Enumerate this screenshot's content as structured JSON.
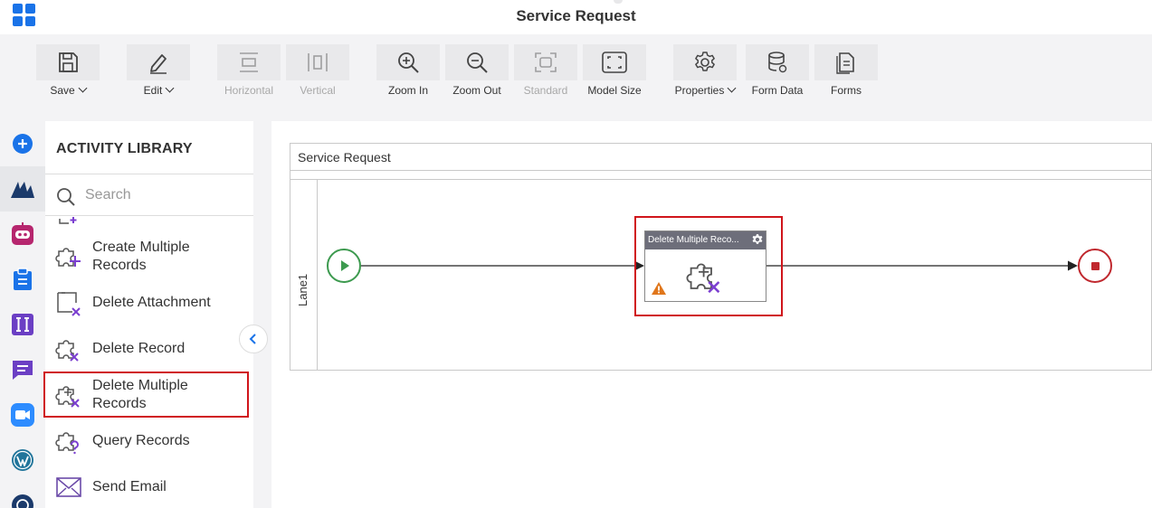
{
  "header": {
    "title": "Service Request"
  },
  "toolbar": {
    "items": [
      {
        "label": "Save",
        "icon": "save-icon"
      },
      {
        "label": "Edit",
        "icon": "pencil-icon"
      },
      {
        "label": "Horizontal",
        "icon": "align-horizontal-icon"
      },
      {
        "label": "Vertical",
        "icon": "align-vertical-icon"
      },
      {
        "label": "Zoom In",
        "icon": "zoom-in-icon"
      },
      {
        "label": "Zoom Out",
        "icon": "zoom-out-icon"
      },
      {
        "label": "Standard",
        "icon": "standard-view-icon"
      },
      {
        "label": "Model Size",
        "icon": "fit-screen-icon"
      },
      {
        "label": "Properties",
        "icon": "gear-icon"
      },
      {
        "label": "Form Data",
        "icon": "database-icon"
      },
      {
        "label": "Forms",
        "icon": "forms-icon"
      }
    ]
  },
  "library": {
    "title": "ACTIVITY LIBRARY",
    "search_placeholder": "Search",
    "items": [
      {
        "label": "Create Multiple Records",
        "icon": "puzzle-plus-icon"
      },
      {
        "label": "Delete Attachment",
        "icon": "attachment-delete-icon"
      },
      {
        "label": "Delete Record",
        "icon": "puzzle-x-icon"
      },
      {
        "label": "Delete Multiple Records",
        "icon": "puzzle-plus-x-icon"
      },
      {
        "label": "Query Records",
        "icon": "puzzle-question-icon"
      },
      {
        "label": "Send Email",
        "icon": "envelope-icon"
      }
    ]
  },
  "canvas": {
    "pool_title": "Service Request",
    "lane_label": "Lane1",
    "task_title": "Delete Multiple Reco..."
  },
  "colors": {
    "accent": "#1a73e8",
    "highlight": "#d0151b",
    "start_event": "#3d9a4f",
    "end_event": "#c0282e",
    "task_header": "#6d6e7a",
    "icon_purple": "#7b3fd0",
    "warning": "#e0761b"
  }
}
